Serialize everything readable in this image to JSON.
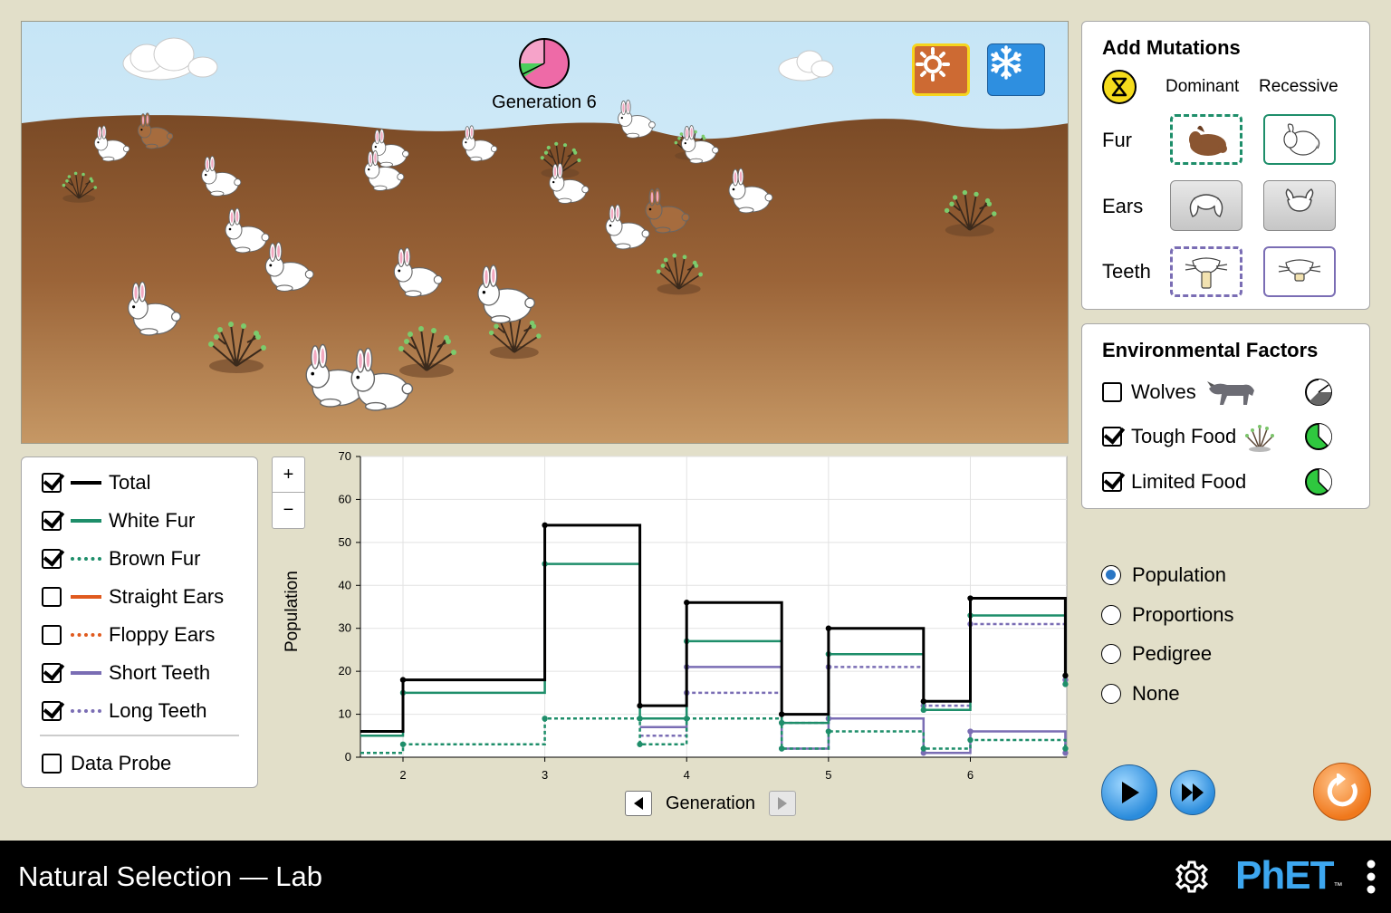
{
  "environment": {
    "generation_label": "Generation 6",
    "summer_icon": "sun-icon",
    "winter_icon": "snowflake-icon"
  },
  "graph_legend": {
    "items": [
      {
        "label": "Total",
        "checked": true,
        "color": "#000000",
        "style": "solid"
      },
      {
        "label": "White Fur",
        "checked": true,
        "color": "#1e8e6a",
        "style": "solid"
      },
      {
        "label": "Brown Fur",
        "checked": true,
        "color": "#1e8e6a",
        "style": "dotted"
      },
      {
        "label": "Straight Ears",
        "checked": false,
        "color": "#e05a1e",
        "style": "solid"
      },
      {
        "label": "Floppy Ears",
        "checked": false,
        "color": "#e05a1e",
        "style": "dotted"
      },
      {
        "label": "Short Teeth",
        "checked": true,
        "color": "#7a6db4",
        "style": "solid"
      },
      {
        "label": "Long Teeth",
        "checked": true,
        "color": "#7a6db4",
        "style": "dotted"
      }
    ],
    "data_probe_label": "Data Probe",
    "data_probe_checked": false
  },
  "mutations": {
    "title": "Add Mutations",
    "col_dominant": "Dominant",
    "col_recessive": "Recessive",
    "rows": [
      "Fur",
      "Ears",
      "Teeth"
    ]
  },
  "environmental_factors": {
    "title": "Environmental Factors",
    "items": [
      {
        "label": "Wolves",
        "checked": false
      },
      {
        "label": "Tough Food",
        "checked": true
      },
      {
        "label": "Limited Food",
        "checked": true
      }
    ]
  },
  "graph_options": {
    "items": [
      {
        "label": "Population",
        "selected": true
      },
      {
        "label": "Proportions",
        "selected": false
      },
      {
        "label": "Pedigree",
        "selected": false
      },
      {
        "label": "None",
        "selected": false
      }
    ]
  },
  "zoom": {
    "in": "+",
    "out": "−"
  },
  "generation_nav_label": "Generation",
  "nav_bar": {
    "title": "Natural Selection — Lab",
    "logo": "PhET"
  },
  "chart_data": {
    "type": "line",
    "ylabel": "Population",
    "xlabel": "Generation",
    "xlim": [
      1.7,
      6.68
    ],
    "ylim": [
      0,
      70
    ],
    "xticks": [
      2,
      3,
      4,
      5,
      6
    ],
    "yticks": [
      0,
      10,
      20,
      30,
      40,
      50,
      60,
      70
    ],
    "series": [
      {
        "name": "Total",
        "color": "#000000",
        "dashed": false,
        "points": [
          [
            1.7,
            6
          ],
          [
            2,
            6
          ],
          [
            2,
            18
          ],
          [
            3,
            18
          ],
          [
            3,
            54
          ],
          [
            3.67,
            54
          ],
          [
            3.67,
            12
          ],
          [
            4,
            12
          ],
          [
            4,
            36
          ],
          [
            4.67,
            36
          ],
          [
            4.67,
            10
          ],
          [
            5,
            10
          ],
          [
            5,
            30
          ],
          [
            5.67,
            30
          ],
          [
            5.67,
            13
          ],
          [
            6,
            13
          ],
          [
            6,
            37
          ],
          [
            6.67,
            37
          ],
          [
            6.67,
            19
          ]
        ]
      },
      {
        "name": "White Fur",
        "color": "#1e8e6a",
        "dashed": false,
        "points": [
          [
            1.7,
            5
          ],
          [
            2,
            5
          ],
          [
            2,
            15
          ],
          [
            3,
            15
          ],
          [
            3,
            45
          ],
          [
            3.67,
            45
          ],
          [
            3.67,
            9
          ],
          [
            4,
            9
          ],
          [
            4,
            27
          ],
          [
            4.67,
            27
          ],
          [
            4.67,
            8
          ],
          [
            5,
            8
          ],
          [
            5,
            24
          ],
          [
            5.67,
            24
          ],
          [
            5.67,
            11
          ],
          [
            6,
            11
          ],
          [
            6,
            33
          ],
          [
            6.67,
            33
          ],
          [
            6.67,
            17
          ]
        ]
      },
      {
        "name": "Brown Fur",
        "color": "#1e8e6a",
        "dashed": true,
        "points": [
          [
            1.7,
            1
          ],
          [
            2,
            1
          ],
          [
            2,
            3
          ],
          [
            3,
            3
          ],
          [
            3,
            9
          ],
          [
            3.67,
            9
          ],
          [
            3.67,
            3
          ],
          [
            4,
            3
          ],
          [
            4,
            9
          ],
          [
            4.67,
            9
          ],
          [
            4.67,
            2
          ],
          [
            5,
            2
          ],
          [
            5,
            6
          ],
          [
            5.67,
            6
          ],
          [
            5.67,
            2
          ],
          [
            6,
            2
          ],
          [
            6,
            4
          ],
          [
            6.67,
            4
          ],
          [
            6.67,
            2
          ]
        ]
      },
      {
        "name": "Short Teeth",
        "color": "#7a6db4",
        "dashed": false,
        "points": [
          [
            3.67,
            7
          ],
          [
            4,
            7
          ],
          [
            4,
            21
          ],
          [
            4.67,
            21
          ],
          [
            4.67,
            2
          ],
          [
            5,
            2
          ],
          [
            5,
            9
          ],
          [
            5.67,
            9
          ],
          [
            5.67,
            1
          ],
          [
            6,
            1
          ],
          [
            6,
            6
          ],
          [
            6.67,
            6
          ],
          [
            6.67,
            1
          ]
        ]
      },
      {
        "name": "Long Teeth",
        "color": "#7a6db4",
        "dashed": true,
        "points": [
          [
            3.67,
            5
          ],
          [
            4,
            5
          ],
          [
            4,
            15
          ],
          [
            4.67,
            15
          ],
          [
            4.67,
            8
          ],
          [
            5,
            8
          ],
          [
            5,
            21
          ],
          [
            5.67,
            21
          ],
          [
            5.67,
            12
          ],
          [
            6,
            12
          ],
          [
            6,
            31
          ],
          [
            6.67,
            31
          ],
          [
            6.67,
            18
          ]
        ]
      }
    ]
  }
}
